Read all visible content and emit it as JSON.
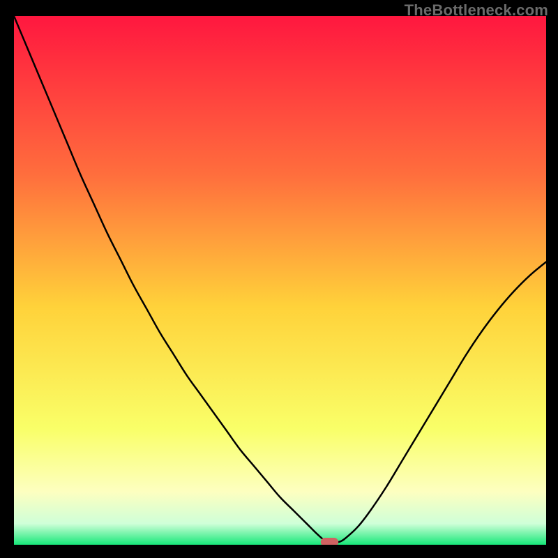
{
  "watermark": "TheBottleneck.com",
  "colors": {
    "frame": "#000000",
    "line": "#000000",
    "marker_fill": "#d06262",
    "marker_stroke": "#d06262",
    "grad_top": "#ff173f",
    "grad_upper_mid": "#ff6e3d",
    "grad_mid": "#ffd23a",
    "grad_lower_mid": "#f9ff68",
    "grad_pale": "#fdffc0",
    "grad_near_bottom": "#cfffd8",
    "grad_bottom": "#17e879"
  },
  "chart_data": {
    "type": "line",
    "title": "",
    "xlabel": "",
    "ylabel": "",
    "xlim": [
      0,
      100
    ],
    "ylim": [
      0,
      100
    ],
    "series": [
      {
        "name": "bottleneck-curve",
        "x": [
          0.0,
          2.5,
          5.0,
          7.5,
          10.0,
          12.5,
          15.0,
          17.5,
          20.0,
          22.5,
          25.0,
          27.5,
          30.0,
          32.5,
          35.0,
          37.5,
          40.0,
          42.5,
          45.0,
          47.5,
          50.0,
          52.5,
          55.0,
          57.0,
          58.7,
          60.0,
          61.3,
          62.6,
          64.7,
          67.0,
          70.0,
          73.0,
          76.0,
          79.0,
          82.0,
          85.0,
          88.0,
          91.0,
          94.0,
          97.0,
          100.0
        ],
        "y": [
          100.0,
          94.0,
          88.0,
          82.0,
          76.0,
          70.0,
          64.5,
          59.0,
          54.0,
          49.0,
          44.5,
          40.0,
          36.0,
          32.0,
          28.5,
          25.0,
          21.5,
          18.0,
          15.0,
          12.0,
          9.0,
          6.5,
          4.0,
          2.0,
          0.6,
          0.5,
          0.6,
          1.5,
          3.5,
          6.5,
          11.0,
          16.0,
          21.0,
          26.0,
          31.0,
          36.0,
          40.5,
          44.5,
          48.0,
          51.0,
          53.5
        ]
      }
    ],
    "marker": {
      "name": "optimal-point",
      "x": 59.3,
      "y": 0.5,
      "shape": "rounded-rect",
      "width": 3.2,
      "height": 1.5
    }
  }
}
